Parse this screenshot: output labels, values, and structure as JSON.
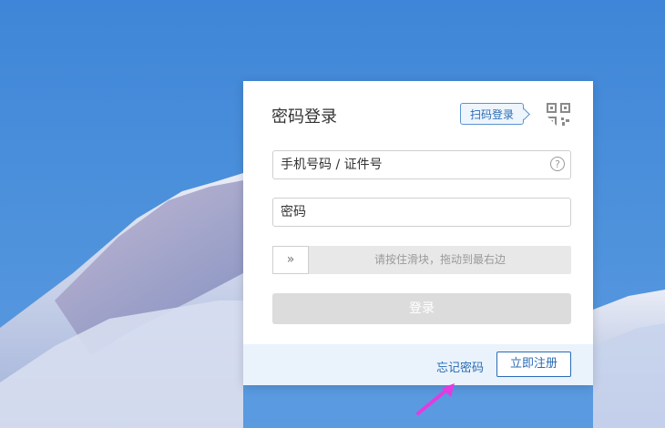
{
  "login": {
    "title": "密码登录",
    "qr_tab_label": "扫码登录",
    "username_placeholder": "手机号码 / 证件号",
    "password_placeholder": "密码",
    "slider_text": "请按住滑块，拖动到最右边",
    "slider_handle": "»",
    "login_button": "登录",
    "help_icon": "?"
  },
  "footer": {
    "forgot_password": "忘记密码",
    "register_button": "立即注册"
  },
  "colors": {
    "accent": "#2a6bb5",
    "footer_bg": "#eaf3fb",
    "button_disabled": "#dcdcdc"
  },
  "icons": {
    "qr": "qr-code-icon",
    "help": "question-circle-icon",
    "slider": "double-chevron-right-icon",
    "annotation": "arrow-icon"
  }
}
